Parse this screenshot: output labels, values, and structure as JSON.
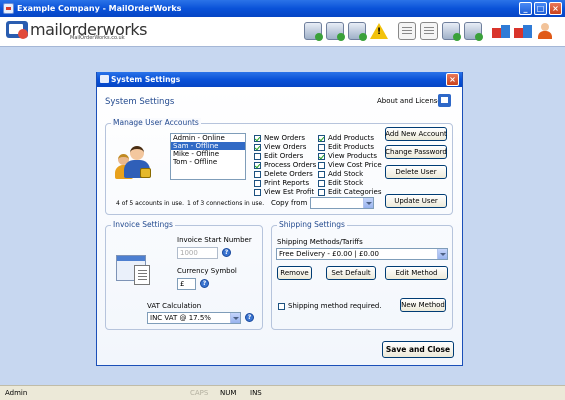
{
  "window": {
    "title": "Example Company - MailOrderWorks"
  },
  "brand": {
    "name": "mailorderworks",
    "url": "MailOrderWorks.co.uk"
  },
  "toolbar": {
    "icons": [
      "computer-add-icon",
      "computer-refresh-icon",
      "computer-search-icon",
      "warning-icon",
      "document-edit-icon",
      "document-info-icon",
      "computer-upload-icon",
      "computer-settings-icon",
      "boxes-icon",
      "people-icon"
    ]
  },
  "status": {
    "user": "Admin",
    "caps": "CAPS",
    "num": "NUM",
    "ins": "INS"
  },
  "dialog": {
    "title": "System Settings",
    "heading": "System Settings",
    "about_label": "About and License",
    "user_accounts": {
      "title": "Manage User Accounts",
      "users": [
        "Admin - Online",
        "Sam - Offline",
        "Mike - Offline",
        "Tom - Offline"
      ],
      "selected_index": 1,
      "permissions_col1": [
        {
          "label": "New Orders",
          "checked": true
        },
        {
          "label": "View Orders",
          "checked": true
        },
        {
          "label": "Edit Orders",
          "checked": false
        },
        {
          "label": "Process Orders",
          "checked": true
        },
        {
          "label": "Delete Orders",
          "checked": false
        },
        {
          "label": "Print Reports",
          "checked": false
        },
        {
          "label": "View Est Profit",
          "checked": false
        }
      ],
      "permissions_col2": [
        {
          "label": "Add Products",
          "checked": true
        },
        {
          "label": "Edit Products",
          "checked": false
        },
        {
          "label": "View Products",
          "checked": true
        },
        {
          "label": "View Cost Price",
          "checked": false
        },
        {
          "label": "Add Stock",
          "checked": false
        },
        {
          "label": "Edit Stock",
          "checked": false
        },
        {
          "label": "Edit Categories",
          "checked": false
        }
      ],
      "accounts_note": "4 of 5 accounts in use.",
      "connections_note": "1 of 3 connections in use.",
      "copy_from_label": "Copy from",
      "copy_from_value": "",
      "add_new_account": "Add New Account",
      "change_password": "Change Password",
      "delete_user": "Delete User",
      "update_user": "Update User"
    },
    "invoice": {
      "title": "Invoice Settings",
      "start_number_label": "Invoice Start Number",
      "start_number_value": "1000",
      "currency_label": "Currency Symbol",
      "currency_value": "£",
      "vat_label": "VAT Calculation",
      "vat_value": "INC VAT @ 17.5%"
    },
    "shipping": {
      "title": "Shipping Settings",
      "methods_label": "Shipping Methods/Tariffs",
      "methods_value": "Free Delivery - £0.00 | £0.00",
      "remove": "Remove",
      "set_default": "Set Default",
      "edit_method": "Edit Method",
      "required_label": "Shipping method required.",
      "required_checked": false,
      "new_method": "New Method"
    },
    "save_close": "Save and Close"
  }
}
